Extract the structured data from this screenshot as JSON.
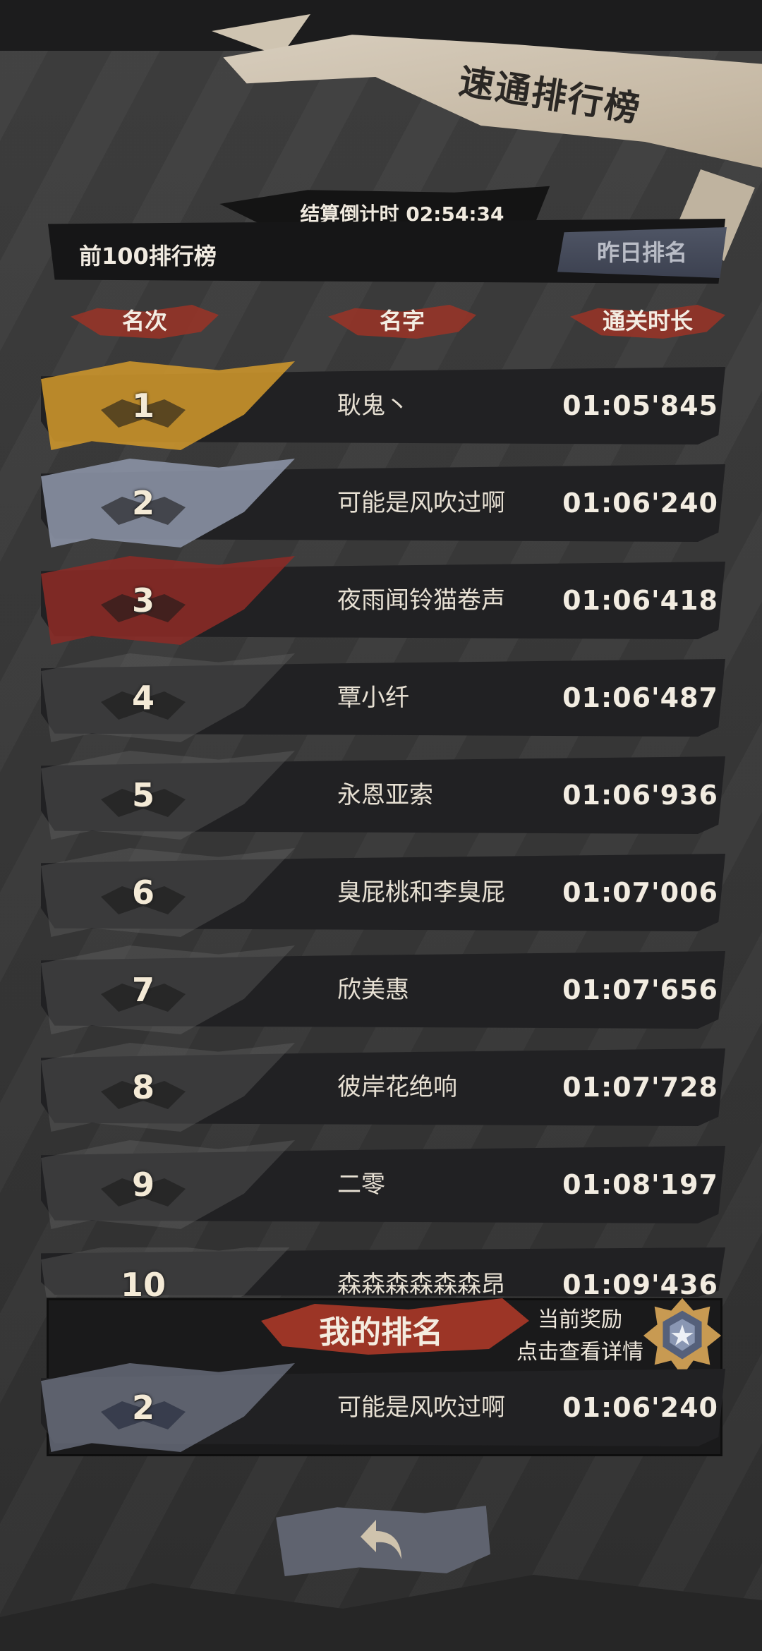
{
  "header": {
    "title": "速通排行榜"
  },
  "countdown": {
    "label": "结算倒计时 02:54:34"
  },
  "tabs": {
    "top100": "前100排行榜",
    "yesterday": "昨日排名"
  },
  "columns": {
    "rank": "名次",
    "name": "名字",
    "time": "通关时长"
  },
  "rows": [
    {
      "rank": "1",
      "name": "耿鬼丶",
      "time": "01:05'845",
      "tier": "gold"
    },
    {
      "rank": "2",
      "name": "可能是风吹过啊",
      "time": "01:06'240",
      "tier": "silver"
    },
    {
      "rank": "3",
      "name": "夜雨闻铃猫卷声",
      "time": "01:06'418",
      "tier": "bronze"
    },
    {
      "rank": "4",
      "name": "覃小纤",
      "time": "01:06'487",
      "tier": "normal"
    },
    {
      "rank": "5",
      "name": "永恩亚索",
      "time": "01:06'936",
      "tier": "normal"
    },
    {
      "rank": "6",
      "name": "臭屁桃和李臭屁",
      "time": "01:07'006",
      "tier": "normal"
    },
    {
      "rank": "7",
      "name": "欣美惠",
      "time": "01:07'656",
      "tier": "normal"
    },
    {
      "rank": "8",
      "name": "彼岸花绝响",
      "time": "01:07'728",
      "tier": "normal"
    },
    {
      "rank": "9",
      "name": "二零",
      "time": "01:08'197",
      "tier": "normal"
    },
    {
      "rank": "10",
      "name": "森森森森森森昂",
      "time": "01:09'436",
      "tier": "normal"
    }
  ],
  "my_rank": {
    "title": "我的排名",
    "reward_line1": "当前奖励",
    "reward_line2": "点击查看详情",
    "rank": "2",
    "name": "可能是风吹过啊",
    "time": "01:06'240"
  },
  "colors": {
    "gold": "#d39a2c",
    "silver": "#8f98ab",
    "bronze": "#8e2a26",
    "normal": "#6b6b6b",
    "accent_red": "#9c3526"
  },
  "icons": {
    "back": "back-arrow-icon",
    "reward": "silver-medal-icon"
  }
}
